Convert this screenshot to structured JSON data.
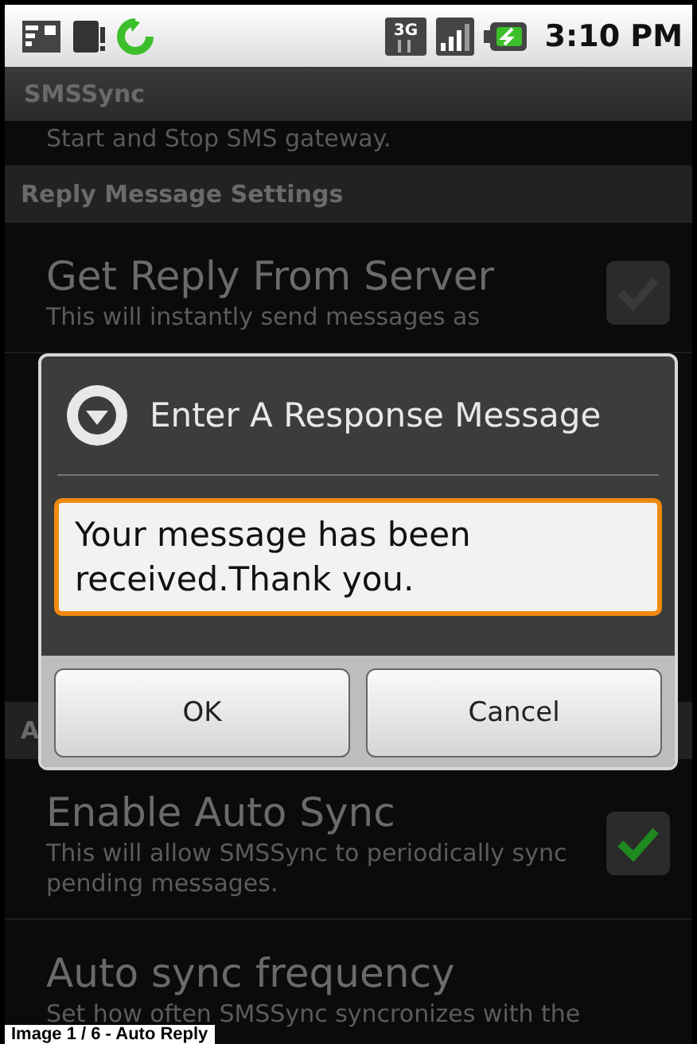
{
  "status_bar": {
    "time": "3:10 PM",
    "network": "3G"
  },
  "app_title": "SMSSync",
  "background": {
    "cut_description": "Start and Stop SMS gateway.",
    "sections": [
      {
        "header": "Reply Message Settings",
        "items": [
          {
            "title": "Get Reply From Server",
            "description": "This will instantly send messages as",
            "checked": false
          }
        ]
      },
      {
        "header": "A",
        "items": [
          {
            "title": "Enable Auto Sync",
            "description": "This will allow SMSSync to periodically sync pending messages.",
            "checked": true
          },
          {
            "title": "Auto sync frequency",
            "description": "Set how often SMSSync syncronizes with the"
          }
        ]
      }
    ]
  },
  "dialog": {
    "title": "Enter A Response Message",
    "value": "Your message has been received.Thank you.",
    "buttons": [
      "OK",
      "Cancel"
    ]
  },
  "caption": "Image 1 / 6 - Auto Reply"
}
